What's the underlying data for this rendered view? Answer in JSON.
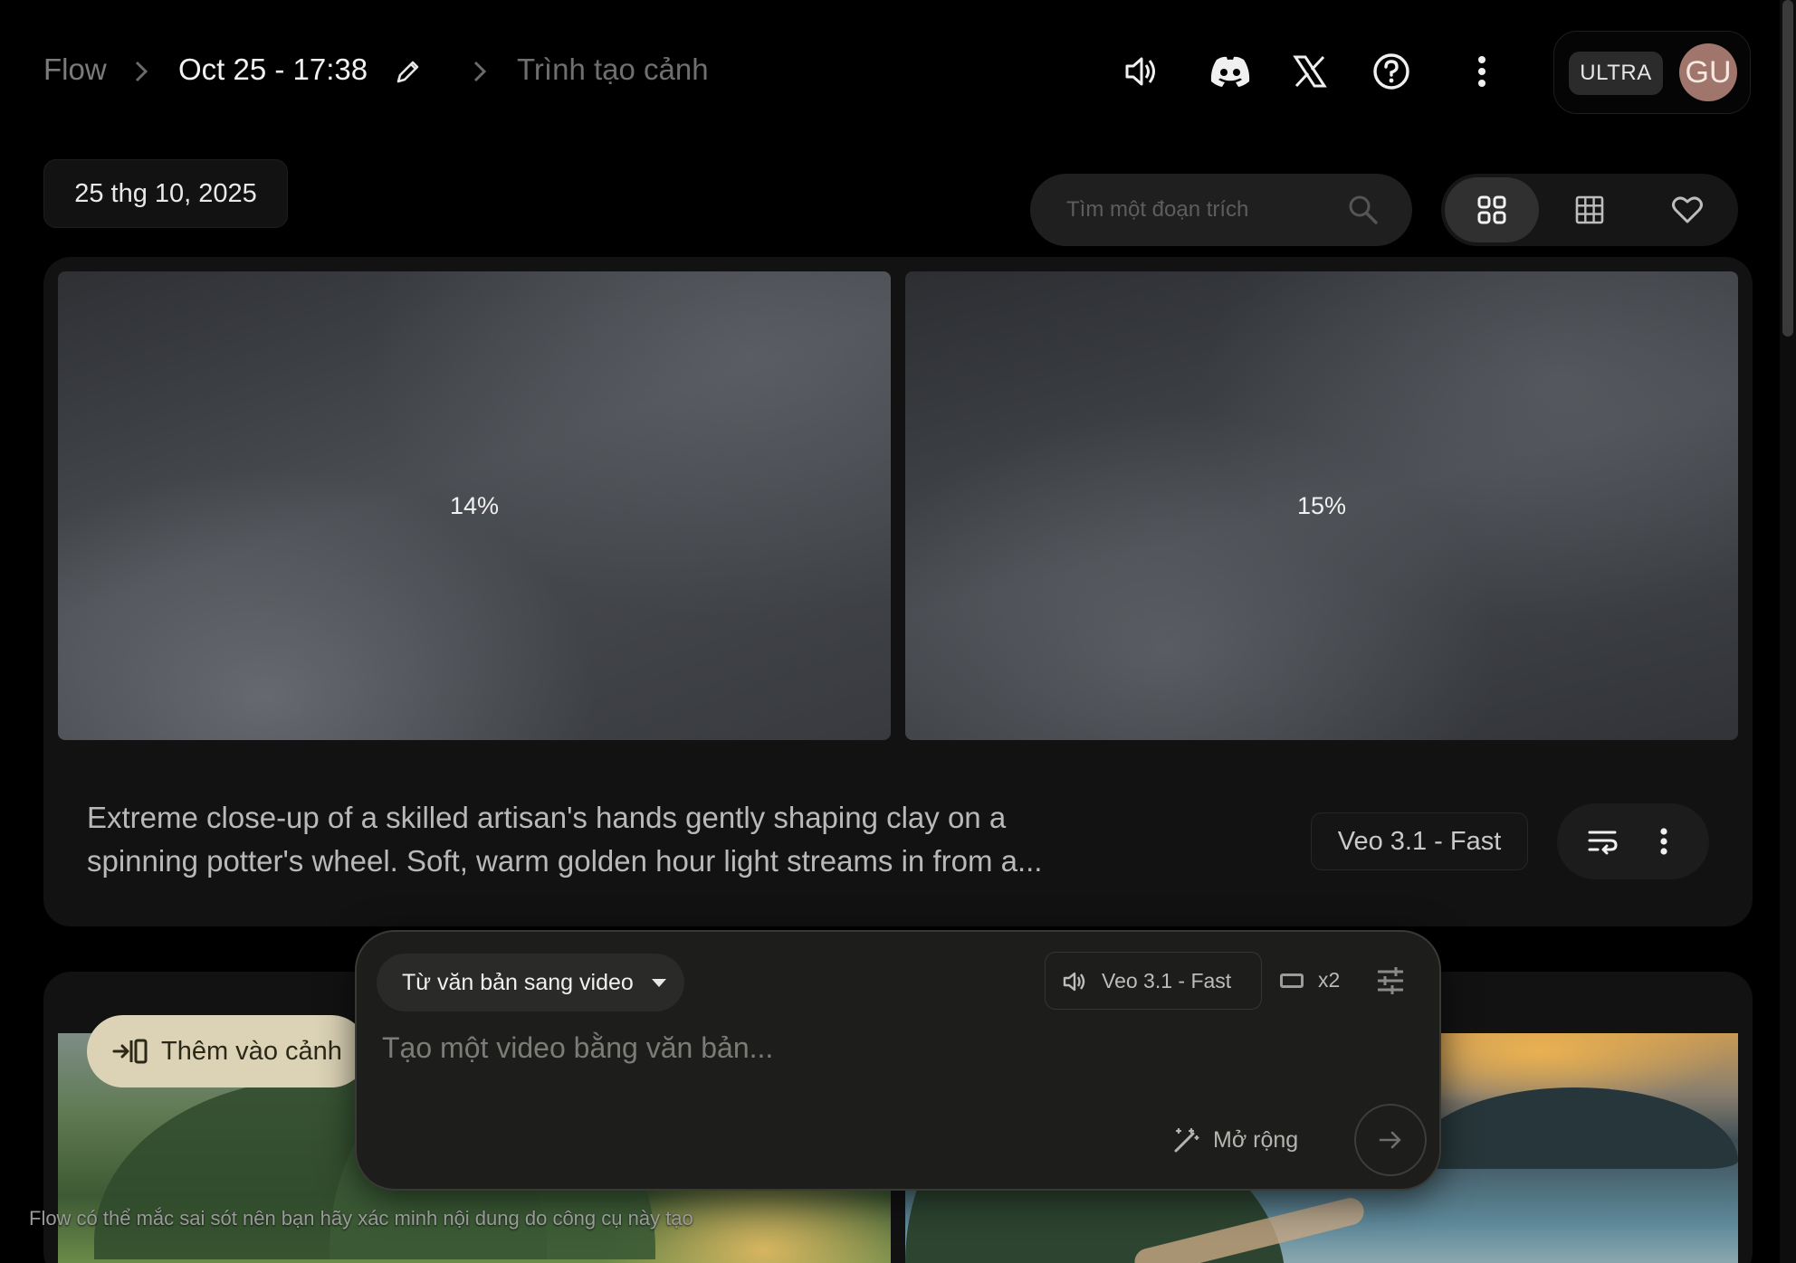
{
  "header": {
    "breadcrumb": {
      "root": "Flow",
      "project": "Oct 25 - 17:38",
      "page": "Trình tạo cảnh"
    },
    "icons": [
      "volume-icon",
      "discord-icon",
      "x-icon",
      "help-icon",
      "more-vert-icon"
    ],
    "plan_badge": "ULTRA",
    "avatar_initials": "GU"
  },
  "toolbar": {
    "date_chip": "25 thg 10, 2025",
    "search_placeholder": "Tìm một đoạn trích video",
    "view_modes": [
      "grid-large",
      "grid-small",
      "favorites"
    ],
    "active_view": "grid-large"
  },
  "cards": [
    {
      "thumbnails": [
        {
          "progress_label": "14%",
          "progress": 0.14
        },
        {
          "progress_label": "15%",
          "progress": 0.15
        }
      ],
      "prompt": "Extreme close-up of a skilled artisan's hands gently shaping clay on a spinning potter's wheel. Soft, warm golden hour light streams in from a...",
      "model": "Veo 3.1 - Fast"
    },
    {
      "add_to_scene_label": "Thêm vào cảnh"
    }
  ],
  "composer": {
    "mode": "Từ văn bản sang video",
    "model": "Veo 3.1 - Fast",
    "output_count": "x2",
    "placeholder": "Tạo một video bằng văn bản...",
    "expand_label": "Mở rộng"
  },
  "disclaimer": "Flow có thể mắc sai sót nên bạn hãy xác minh nội dung do công cụ này tạo",
  "colors": {
    "background": "#000000",
    "card": "#121212",
    "add_scene_chip": "#dcd3b6",
    "avatar": "#a0756b"
  }
}
